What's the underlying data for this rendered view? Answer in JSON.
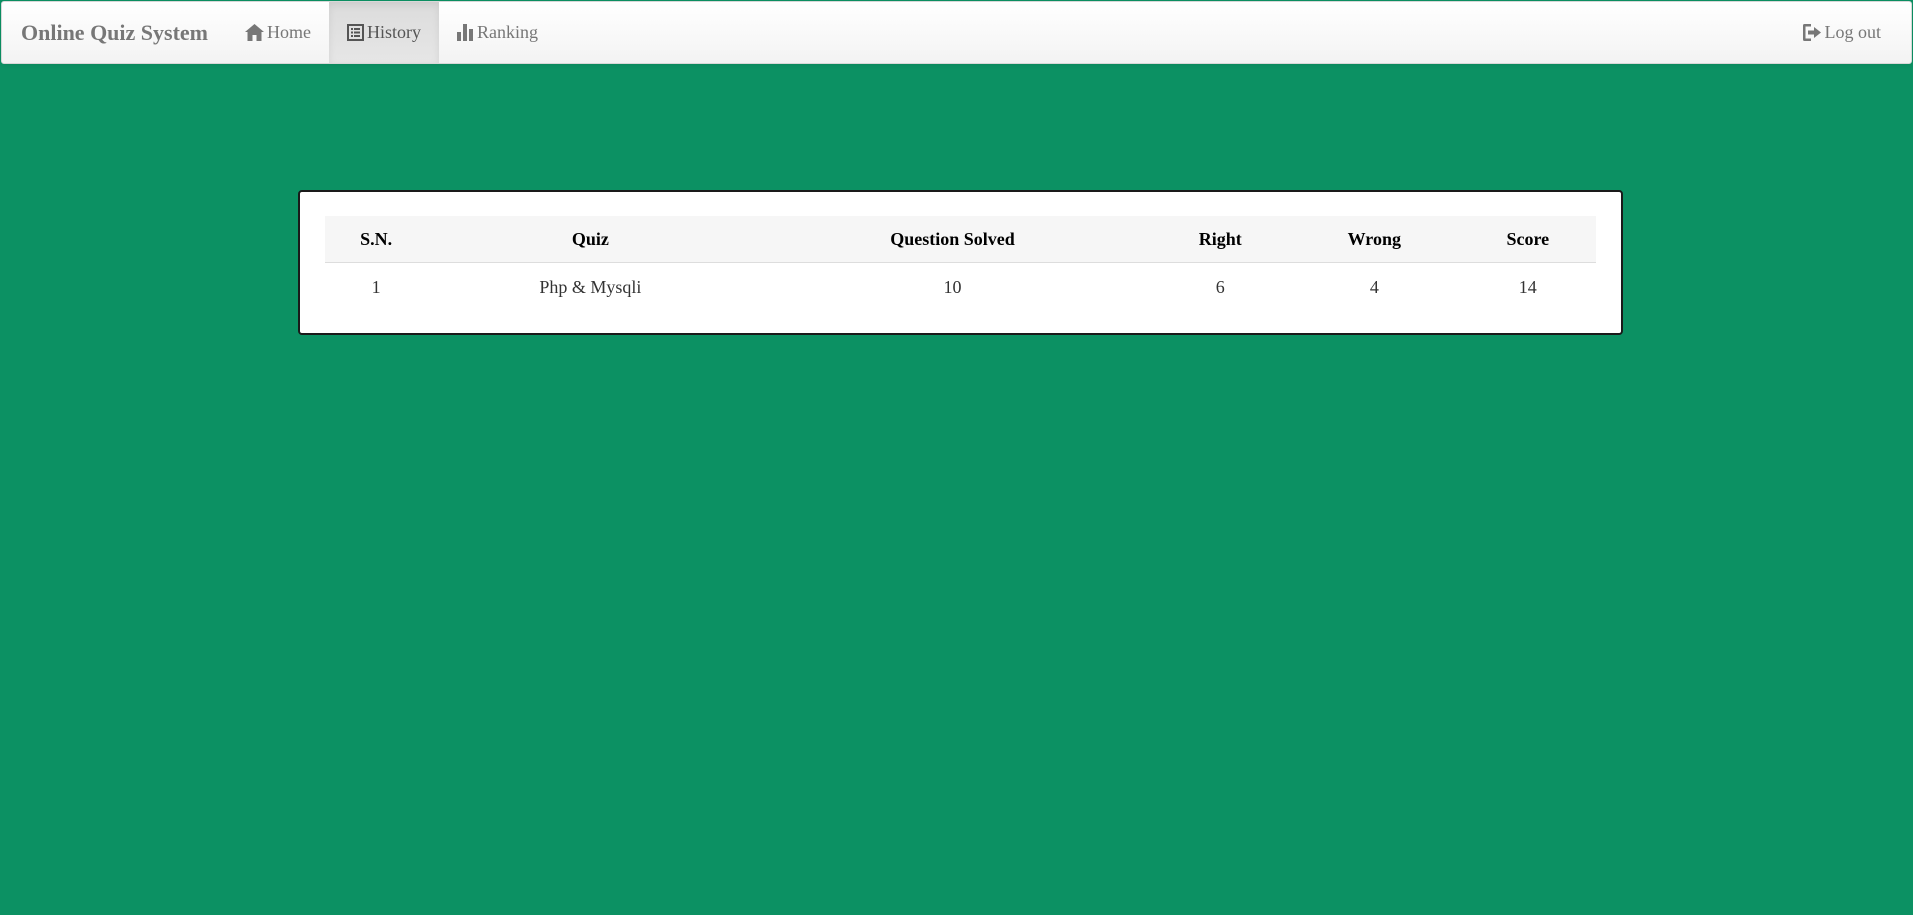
{
  "navbar": {
    "brand": "Online Quiz System",
    "items": [
      {
        "label": "Home",
        "icon": "home-icon",
        "active": false
      },
      {
        "label": "History",
        "icon": "list-icon",
        "active": true
      },
      {
        "label": "Ranking",
        "icon": "bar-chart-icon",
        "active": false
      }
    ],
    "logout": {
      "label": "Log out",
      "icon": "logout-icon"
    }
  },
  "history_table": {
    "headers": [
      "S.N.",
      "Quiz",
      "Question Solved",
      "Right",
      "Wrong",
      "Score"
    ],
    "rows": [
      [
        "1",
        "Php & Mysqli",
        "10",
        "6",
        "4",
        "14"
      ]
    ]
  },
  "colors": {
    "background": "#0c9163",
    "navbar_text": "#777777",
    "panel_border": "#1a1a1a"
  }
}
